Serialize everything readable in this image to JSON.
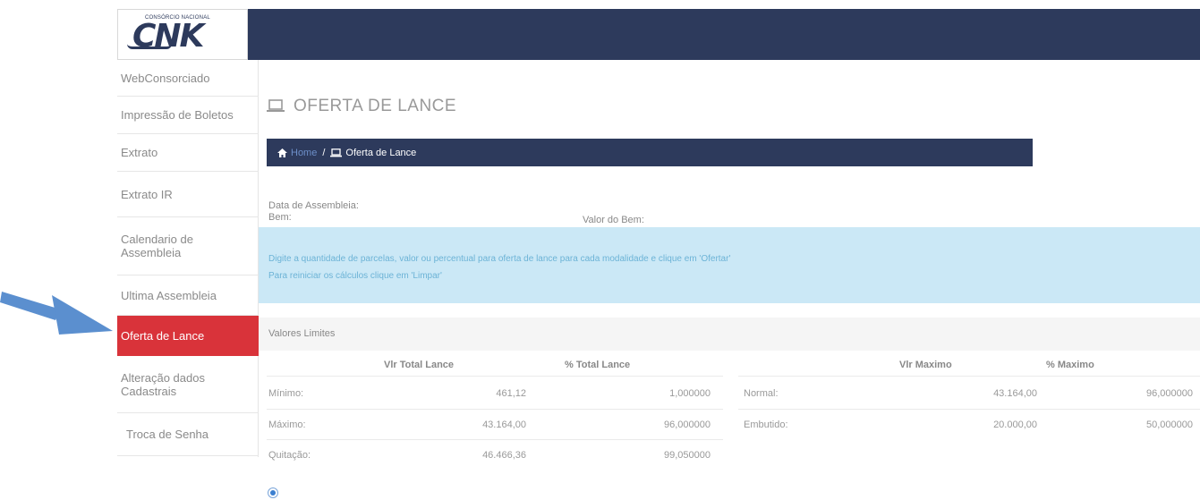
{
  "brand": {
    "tagline": "CONSÓRCIO NACIONAL",
    "mark": "CNK"
  },
  "sidebar": {
    "items": [
      {
        "label": "WebConsorciado"
      },
      {
        "label": "Impressão de Boletos"
      },
      {
        "label": "Extrato"
      },
      {
        "label": "Extrato IR"
      },
      {
        "label": "Calendario de Assembleia"
      },
      {
        "label": "Ultima Assembleia"
      },
      {
        "label": "Oferta de Lance"
      },
      {
        "label": "Alteração dados Cadastrais"
      },
      {
        "label": "Troca de Senha"
      }
    ],
    "active_color": "#d9333a"
  },
  "page": {
    "title": "OFERTA DE LANCE",
    "breadcrumb": {
      "home": "Home",
      "sep": "/",
      "current": "Oferta de Lance"
    }
  },
  "details": {
    "data_assembleia": "Data de Assembleia:",
    "bem": "Bem:",
    "valor_bem": "Valor do Bem:"
  },
  "info": {
    "line1": "Digite a quantidade de parcelas, valor ou percentual para oferta de lance para cada modalidade e clique em 'Ofertar'",
    "line2": "Para reiniciar os cálculos clique em 'Limpar'"
  },
  "limits": {
    "header": "Valores Limites",
    "left": {
      "col1": "Vlr Total Lance",
      "col2": "% Total Lance",
      "rows": [
        {
          "label": "Mínimo:",
          "value": "461,12",
          "pct": "1,000000"
        },
        {
          "label": "Máximo:",
          "value": "43.164,00",
          "pct": "96,000000"
        },
        {
          "label": "Quitação:",
          "value": "46.466,36",
          "pct": "99,050000"
        }
      ]
    },
    "right": {
      "col1": "Vlr Maximo",
      "col2": "% Maximo",
      "rows": [
        {
          "label": "Normal:",
          "value": "43.164,00",
          "pct": "96,000000"
        },
        {
          "label": "Embutido:",
          "value": "20.000,00",
          "pct": "50,000000"
        }
      ]
    }
  },
  "colors": {
    "navy": "#2d3a5c",
    "info_bg": "#cbe8f6",
    "arrow": "#5b8fcf"
  }
}
